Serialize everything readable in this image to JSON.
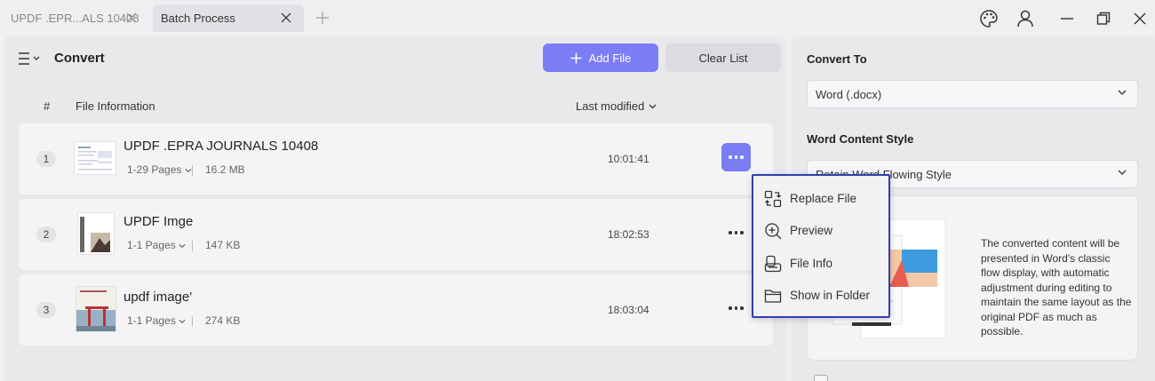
{
  "tabs": [
    {
      "label": "UPDF .EPR...ALS 10408",
      "active": false
    },
    {
      "label": "Batch Process",
      "active": true
    }
  ],
  "panel": {
    "title": "Convert",
    "add_file_label": "Add File",
    "clear_list_label": "Clear List"
  },
  "table": {
    "col_index": "#",
    "col_info": "File Information",
    "col_modified": "Last modified"
  },
  "files": [
    {
      "index": "1",
      "name": "UPDF .EPRA JOURNALS 10408",
      "pages": "1-29 Pages",
      "size": "16.2 MB",
      "time": "10:01:41"
    },
    {
      "index": "2",
      "name": "UPDF Imge",
      "pages": "1-1 Pages",
      "size": "147 KB",
      "time": "18:02:53"
    },
    {
      "index": "3",
      "name": "updf image'",
      "pages": "1-1 Pages",
      "size": "274 KB",
      "time": "18:03:04"
    }
  ],
  "context_menu": {
    "items": [
      {
        "label": "Replace File",
        "icon": "replace-icon"
      },
      {
        "label": "Preview",
        "icon": "zoom-in-icon"
      },
      {
        "label": "File Info",
        "icon": "file-info-icon"
      },
      {
        "label": "Show in Folder",
        "icon": "folder-icon"
      }
    ]
  },
  "settings": {
    "convert_to_title": "Convert To",
    "convert_to_value": "Word (.docx)",
    "content_style_title": "Word Content Style",
    "content_style_value": "Retain Word Flowing Style",
    "description": "The converted content will be presented in Word's classic flow display, with automatic adjustment during editing to maintain the same layout as the original PDF as much as possible."
  },
  "colors": {
    "accent": "#7b7df5",
    "menu_border": "#2f3fb0"
  }
}
